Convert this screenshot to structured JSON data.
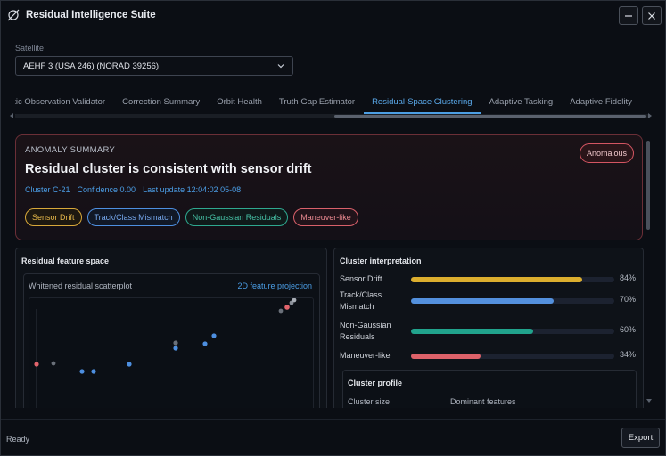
{
  "window": {
    "title": "Residual Intelligence Suite",
    "app_icon": "satellite-orbit-icon",
    "minimize_icon": "minimize-icon",
    "close_icon": "close-icon"
  },
  "satellite": {
    "label": "Satellite",
    "value": "AEHF 3 (USA 246) (NORAD 39256)"
  },
  "tabs": [
    {
      "label": "etic Observation Validator",
      "active": false
    },
    {
      "label": "Correction Summary",
      "active": false
    },
    {
      "label": "Orbit Health",
      "active": false
    },
    {
      "label": "Truth Gap Estimator",
      "active": false
    },
    {
      "label": "Residual-Space Clustering",
      "active": true
    },
    {
      "label": "Adaptive Tasking",
      "active": false
    },
    {
      "label": "Adaptive Fidelity",
      "active": false
    }
  ],
  "summary": {
    "heading": "ANOMALY SUMMARY",
    "headline": "Residual cluster is consistent with sensor drift",
    "cluster": "Cluster C-21",
    "confidence": "Confidence 0.00",
    "last_update": "Last update 12:04:02 05-08",
    "badge": "Anomalous",
    "chips": [
      {
        "label": "Sensor Drift",
        "color": "#d8a83a"
      },
      {
        "label": "Track/Class Mismatch",
        "color": "#4d8fe0"
      },
      {
        "label": "Non-Gaussian Residuals",
        "color": "#2ea88f"
      },
      {
        "label": "Maneuver-like",
        "color": "#d9606a"
      }
    ]
  },
  "feature_space": {
    "title": "Residual feature space",
    "subtitle": "Whitened residual scatterplot",
    "projection": "2D feature projection"
  },
  "interpretation": {
    "title": "Cluster interpretation",
    "items": [
      {
        "label": "Sensor Drift",
        "value": 84,
        "pct_text": "84%",
        "color": "#dcae2e"
      },
      {
        "label": "Track/Class Mismatch",
        "value": 70,
        "pct_text": "70%",
        "color": "#5390dd"
      },
      {
        "label": "Non-Gaussian Residuals",
        "value": 60,
        "pct_text": "60%",
        "color": "#21a38c"
      },
      {
        "label": "Maneuver-like",
        "value": 34,
        "pct_text": "34%",
        "color": "#dd6169"
      }
    ]
  },
  "profile": {
    "title": "Cluster profile",
    "col1": "Cluster size",
    "col2": "Dominant features"
  },
  "status": {
    "text": "Ready",
    "export_label": "Export"
  }
}
